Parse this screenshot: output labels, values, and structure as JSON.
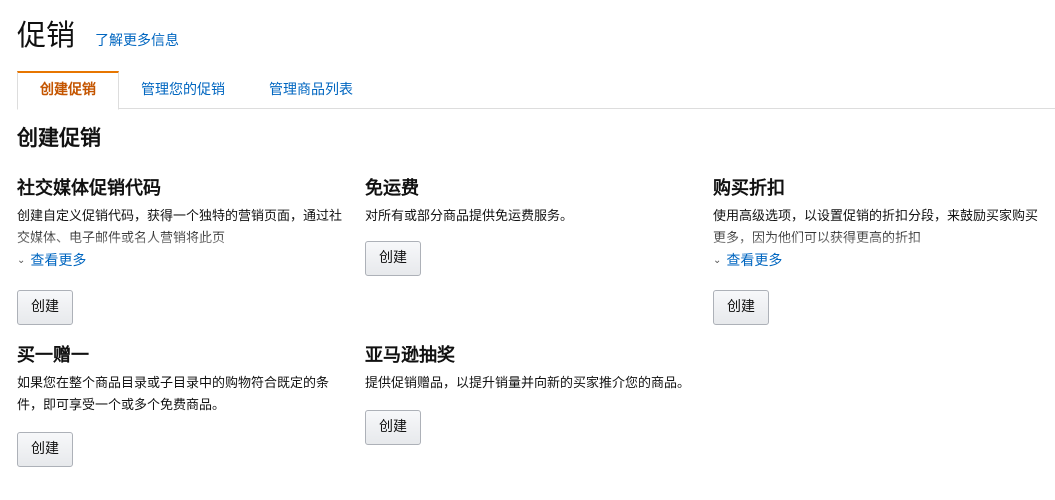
{
  "header": {
    "title": "促销",
    "learn_more": "了解更多信息"
  },
  "tabs": [
    {
      "label": "创建促销",
      "active": true
    },
    {
      "label": "管理您的促销"
    },
    {
      "label": "管理商品列表"
    }
  ],
  "section_title": "创建促销",
  "cards": [
    {
      "title": "社交媒体促销代码",
      "desc": "创建自定义促销代码，获得一个独特的营销页面，通过社交媒体、电子邮件或名人营销将此页",
      "see_more": "查看更多",
      "button": "创建"
    },
    {
      "title": "免运费",
      "desc": "对所有或部分商品提供免运费服务。",
      "button": "创建"
    },
    {
      "title": "购买折扣",
      "desc": "使用高级选项，以设置促销的折扣分段，来鼓励买家购买更多，因为他们可以获得更高的折扣",
      "see_more": "查看更多",
      "button": "创建"
    },
    {
      "title": "买一赠一",
      "desc": "如果您在整个商品目录或子目录中的购物符合既定的条件，即可享受一个或多个免费商品。",
      "button": "创建"
    },
    {
      "title": "亚马逊抽奖",
      "desc": "提供促销赠品，以提升销量并向新的买家推介您的商品。",
      "button": "创建"
    }
  ]
}
